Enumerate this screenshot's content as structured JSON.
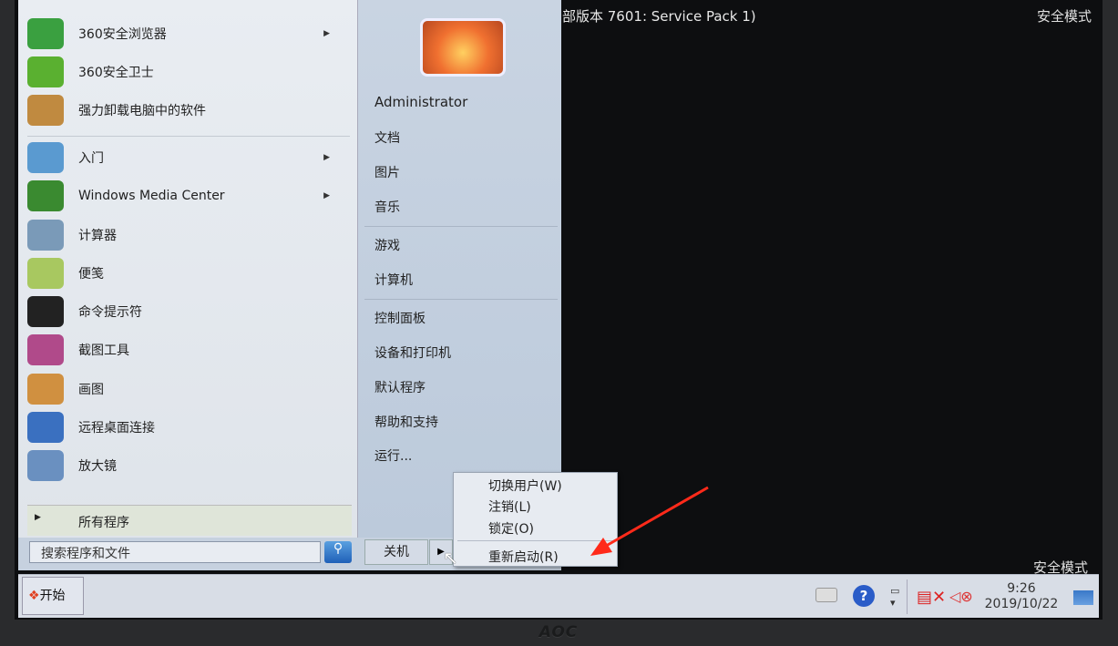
{
  "top_info": "部版本 7601: Service Pack 1)",
  "safe_mode": "安全模式",
  "pinned": [
    {
      "label": "360安全浏览器",
      "icon": "ie-360-icon",
      "submenu": true
    },
    {
      "label": "360安全卫士",
      "icon": "shield-360-icon",
      "submenu": false
    },
    {
      "label": "强力卸载电脑中的软件",
      "icon": "uninstall-icon",
      "submenu": false
    }
  ],
  "recent": [
    {
      "label": "入门",
      "icon": "getting-started-icon",
      "submenu": true
    },
    {
      "label": "Windows Media Center",
      "icon": "media-center-icon",
      "submenu": true
    },
    {
      "label": "计算器",
      "icon": "calculator-icon",
      "submenu": false
    },
    {
      "label": "便笺",
      "icon": "sticky-notes-icon",
      "submenu": false
    },
    {
      "label": "命令提示符",
      "icon": "cmd-icon",
      "submenu": false
    },
    {
      "label": "截图工具",
      "icon": "snipping-tool-icon",
      "submenu": false
    },
    {
      "label": "画图",
      "icon": "paint-icon",
      "submenu": false
    },
    {
      "label": "远程桌面连接",
      "icon": "remote-desktop-icon",
      "submenu": false
    },
    {
      "label": "放大镜",
      "icon": "magnifier-icon",
      "submenu": false
    }
  ],
  "all_programs": "所有程序",
  "search_placeholder": "搜索程序和文件",
  "right": [
    "Administrator",
    "文档",
    "图片",
    "音乐",
    "游戏",
    "计算机",
    "控制面板",
    "设备和打印机",
    "默认程序",
    "帮助和支持",
    "运行..."
  ],
  "shutdown": "关机",
  "shutdown_menu": [
    "切换用户(W)",
    "注销(L)",
    "锁定(O)",
    "重新启动(R)"
  ],
  "start": "开始",
  "clock": {
    "time": "9:26",
    "date": "2019/10/22"
  },
  "brand": "AOC",
  "colors": {
    "annotation_arrow": "#ff2a1a",
    "desktop": "#0d0e10"
  }
}
